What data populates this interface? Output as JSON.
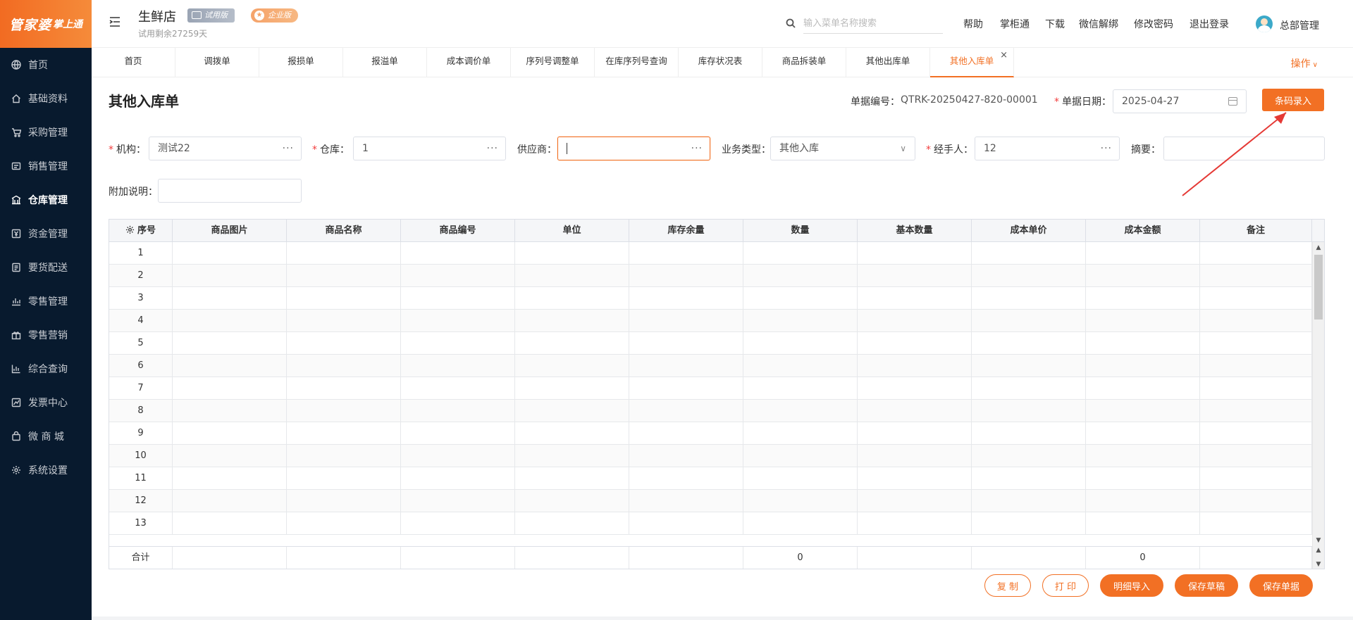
{
  "app": {
    "logo_main": "管家婆",
    "logo_sub": "掌上通",
    "store_name": "生鲜店",
    "trial_badge": "试用版",
    "enterprise_badge": "企业版",
    "trial_remaining": "试用剩余27259天"
  },
  "sidebar": {
    "items": [
      {
        "label": "首页",
        "icon": "globe-icon"
      },
      {
        "label": "基础资料",
        "icon": "home-icon"
      },
      {
        "label": "采购管理",
        "icon": "cart-icon"
      },
      {
        "label": "销售管理",
        "icon": "sales-icon"
      },
      {
        "label": "仓库管理",
        "icon": "warehouse-icon",
        "active": true
      },
      {
        "label": "资金管理",
        "icon": "money-icon"
      },
      {
        "label": "要货配送",
        "icon": "list-icon"
      },
      {
        "label": "零售管理",
        "icon": "bar-chart-icon"
      },
      {
        "label": "零售营销",
        "icon": "gift-icon"
      },
      {
        "label": "综合查询",
        "icon": "chart-icon"
      },
      {
        "label": "发票中心",
        "icon": "line-chart-icon"
      },
      {
        "label": "微 商 城",
        "icon": "bag-icon"
      },
      {
        "label": "系统设置",
        "icon": "gear-icon"
      }
    ]
  },
  "header": {
    "search_placeholder": "输入菜单名称搜索",
    "links": [
      "帮助",
      "掌柜通",
      "下载",
      "微信解绑",
      "修改密码",
      "退出登录"
    ],
    "user_name": "总部管理"
  },
  "tabs": [
    {
      "label": "首页"
    },
    {
      "label": "调拨单"
    },
    {
      "label": "报损单"
    },
    {
      "label": "报溢单"
    },
    {
      "label": "成本调价单"
    },
    {
      "label": "序列号调整单"
    },
    {
      "label": "在库序列号查询"
    },
    {
      "label": "库存状况表"
    },
    {
      "label": "商品拆装单"
    },
    {
      "label": "其他出库单"
    },
    {
      "label": "其他入库单",
      "active": true,
      "close": "×"
    }
  ],
  "operations_label": "操作",
  "form": {
    "title": "其他入库单",
    "doc_no_label": "单据编号：",
    "doc_no": "QTRK-20250427-820-00001",
    "doc_date_label": "单据日期：",
    "doc_date": "2025-04-27",
    "barcode_button": "条码录入",
    "org_label": "机构：",
    "org_value": "测试22",
    "warehouse_label": "仓库：",
    "warehouse_value": "1",
    "supplier_label": "供应商：",
    "supplier_value": "",
    "biz_type_label": "业务类型：",
    "biz_type_value": "其他入库",
    "handler_label": "经手人：",
    "handler_value": "12",
    "summary_label": "摘要：",
    "summary_value": "",
    "remark_label": "附加说明：",
    "remark_value": "",
    "required_mark": "*",
    "more_dots": "···"
  },
  "table": {
    "columns": [
      "序号",
      "商品图片",
      "商品名称",
      "商品编号",
      "单位",
      "库存余量",
      "数量",
      "基本数量",
      "成本单价",
      "成本金额",
      "备注"
    ],
    "rows": [
      "1",
      "2",
      "3",
      "4",
      "5",
      "6",
      "7",
      "8",
      "9",
      "10",
      "11",
      "12",
      "13"
    ],
    "footer": {
      "label": "合计",
      "quantity_total": "0",
      "cost_total": "0"
    }
  },
  "actions": {
    "copy": "复 制",
    "print": "打 印",
    "detail_import": "明细导入",
    "save_draft": "保存草稿",
    "save_doc": "保存单据"
  },
  "colors": {
    "accent": "#f27024",
    "sidebar_bg": "#081a2e",
    "annotation": "#e53935"
  }
}
